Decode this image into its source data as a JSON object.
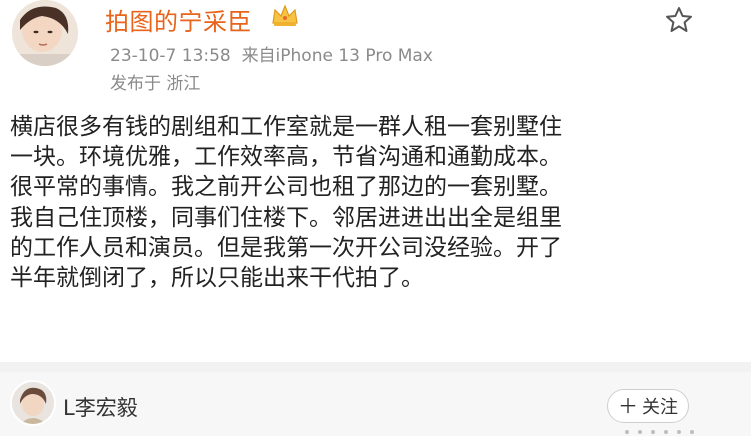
{
  "post": {
    "author_name": "拍图的宁采臣",
    "timestamp": "23-10-7 13:58",
    "source": "来自iPhone 13 Pro Max",
    "location": "发布于 浙江",
    "body_lines": [
      "横店很多有钱的剧组和工作室就是一群人租一套别墅住",
      "一块。环境优雅，工作效率高，节省沟通和通勤成本。",
      "很平常的事情。我之前开公司也租了那边的一套别墅。",
      "我自己住顶楼，同事们住楼下。邻居进进出出全是组里",
      "的工作人员和演员。但是我第一次开公司没经验。开了",
      "半年就倒闭了，所以只能出来干代拍了。"
    ],
    "badge_icon": "crown-icon",
    "favorite_icon": "star-icon"
  },
  "comment_user": {
    "name": "L李宏毅",
    "follow_label": "关注",
    "follow_icon": "plus-icon"
  },
  "colors": {
    "author_name": "#e8641b",
    "meta_text": "#8a8a8a",
    "divider": "#f2f2f2"
  }
}
